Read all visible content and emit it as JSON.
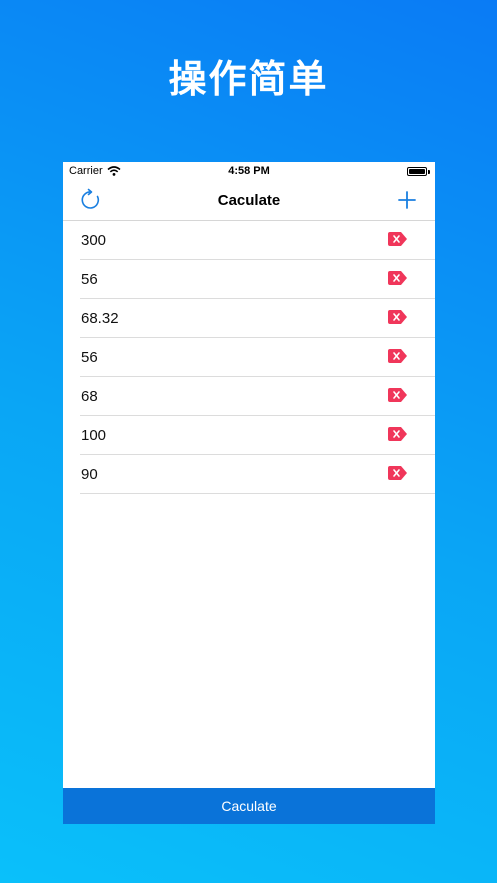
{
  "headline": "操作简单",
  "status_bar": {
    "carrier": "Carrier",
    "time": "4:58 PM"
  },
  "nav": {
    "title": "Caculate",
    "left_icon": "refresh-icon",
    "right_icon": "plus-icon"
  },
  "items": [
    {
      "value": "300"
    },
    {
      "value": "56"
    },
    {
      "value": "68.32"
    },
    {
      "value": "56"
    },
    {
      "value": "68"
    },
    {
      "value": "100"
    },
    {
      "value": "90"
    }
  ],
  "bottom_button": {
    "label": "Caculate"
  },
  "colors": {
    "accent": "#1a7fe0",
    "delete": "#f0365a",
    "button": "#0a73d9"
  }
}
